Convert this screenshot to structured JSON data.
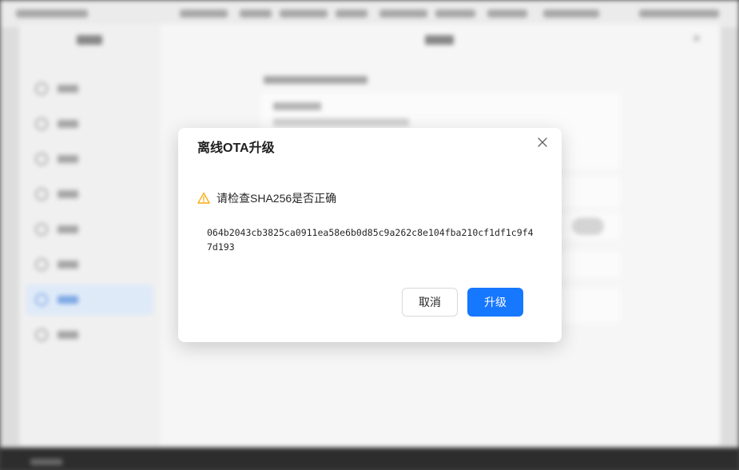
{
  "dialog": {
    "title": "离线OTA升级",
    "warning": "请检查SHA256是否正确",
    "hash": "064b2043cb3825ca0911ea58e6b0d85c9a262c8e104fba210cf1df1c9f47d193",
    "cancel_label": "取消",
    "confirm_label": "升级"
  },
  "icons": {
    "close": "close-icon",
    "warning": "warning-icon"
  },
  "colors": {
    "primary": "#1677ff",
    "warning": "#faad14"
  }
}
